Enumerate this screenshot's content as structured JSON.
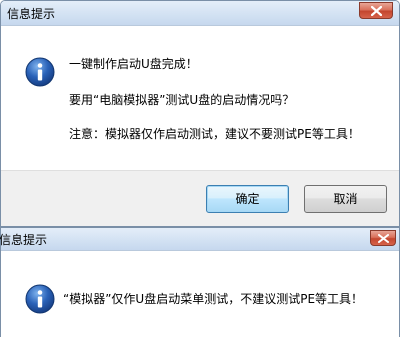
{
  "dialog1": {
    "title": "信息提示",
    "icon": "info-icon",
    "messages": [
      "一键制作启动U盘完成！",
      "要用“电脑模拟器”测试U盘的启动情况吗？",
      "注意：模拟器仅作启动测试，建议不要测试PE等工具！"
    ],
    "ok_label": "确定",
    "cancel_label": "取消"
  },
  "dialog2": {
    "title": "信息提示",
    "icon": "info-icon",
    "message": "“模拟器”仅作U盘启动菜单测试，不建议测试PE等工具！"
  },
  "colors": {
    "titlebar": "#d3e2f3",
    "close_button": "#c4462f",
    "info_icon": "#2a62b8",
    "button_area": "#f0f0f0",
    "default_button_border": "#3c7fb1"
  }
}
